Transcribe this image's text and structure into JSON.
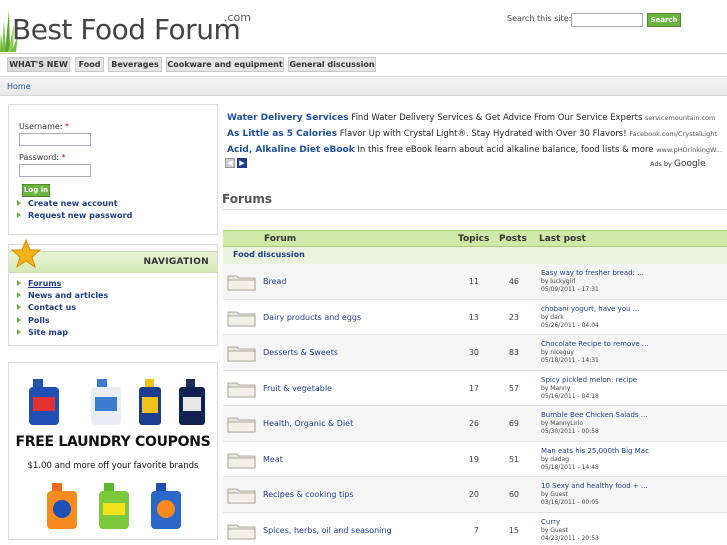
{
  "header": {
    "logo_text": "Best Food Forum",
    "logo_com": ".com",
    "search_label": "Search this site:",
    "search_value": "",
    "search_button": "Search"
  },
  "tabs": [
    "WHAT'S NEW",
    "Food",
    "Beverages",
    "Cookware and equipment",
    "General discussion"
  ],
  "breadcrumb": "Home",
  "login": {
    "username_label": "Username:",
    "password_label": "Password:",
    "required_mark": "*",
    "username_value": "",
    "password_value": "",
    "login_button": "Log in",
    "links": [
      "Create new account",
      "Request new password"
    ]
  },
  "navigation": {
    "title": "NAVIGATION",
    "items": [
      "Forums",
      "News and articles",
      "Contact us",
      "Polls",
      "Site map"
    ]
  },
  "ad_banner": {
    "title": "FREE LAUNDRY COUPONS",
    "subtitle": "$1.00 and more off your favorite brands"
  },
  "sponsored": [
    {
      "title": "Water Delivery Services",
      "text": "Find Water Delivery Services & Get Advice From Our Service Experts",
      "source": "servicemountain.com"
    },
    {
      "title": "As Little as 5 Calories",
      "text": "Flavor Up with Crystal Light®. Stay Hydrated with Over 30 Flavors!",
      "source": "Facebook.com/CrystalLight"
    },
    {
      "title": "Acid, Alkaline Diet eBook",
      "text": "In this free eBook learn about acid alkaline balance, food lists & more",
      "source": "www.pHDrinkingW..."
    }
  ],
  "ads_by": {
    "prefix": "Ads by",
    "brand": "Google"
  },
  "forums": {
    "title": "Forums",
    "columns": {
      "forum": "Forum",
      "topics": "Topics",
      "posts": "Posts",
      "last_post": "Last post"
    },
    "category": "Food discussion",
    "rows": [
      {
        "name": "Bread",
        "topics": "11",
        "posts": "46",
        "last_title": "Easy way to fresher bread: ...",
        "last_by": "by luckygirl",
        "last_date": "05/09/2011 - 17:31"
      },
      {
        "name": "Dairy products and eggs",
        "topics": "13",
        "posts": "23",
        "last_title": "chobani yogurt, have you ...",
        "last_by": "by dark",
        "last_date": "05/26/2011 - 04:04"
      },
      {
        "name": "Desserts & Sweets",
        "topics": "30",
        "posts": "83",
        "last_title": "Chocolate Recipe to remove ...",
        "last_by": "by niceguy",
        "last_date": "05/18/2011 - 14:31"
      },
      {
        "name": "Fruit & vegetable",
        "topics": "17",
        "posts": "57",
        "last_title": "Spicy pickled melon: recipe",
        "last_by": "by Manny",
        "last_date": "05/16/2011 - 04:18"
      },
      {
        "name": "Health, Organic & Diet",
        "topics": "26",
        "posts": "69",
        "last_title": "Bumble Bee Chicken Salads ...",
        "last_by": "by MannyLirio",
        "last_date": "05/30/2011 - 00:58"
      },
      {
        "name": "Meat",
        "topics": "19",
        "posts": "51",
        "last_title": "Man eats his 25,000th Big Mac",
        "last_by": "by dadag",
        "last_date": "05/18/2011 - 14:48"
      },
      {
        "name": "Recipes & cooking tips",
        "topics": "20",
        "posts": "60",
        "last_title": "10 Sexy and healthy food + ...",
        "last_by": "by Guest",
        "last_date": "03/16/2011 - 00:05"
      },
      {
        "name": "Spices, herbs, oil and seasoning",
        "topics": "7",
        "posts": "15",
        "last_title": "Curry",
        "last_by": "by Guest",
        "last_date": "04/23/2011 - 20:53"
      }
    ]
  },
  "colors": {
    "accent_green": "#6cb33f",
    "link_blue": "#1f3d8a",
    "header_green": "#cfe9a8"
  }
}
